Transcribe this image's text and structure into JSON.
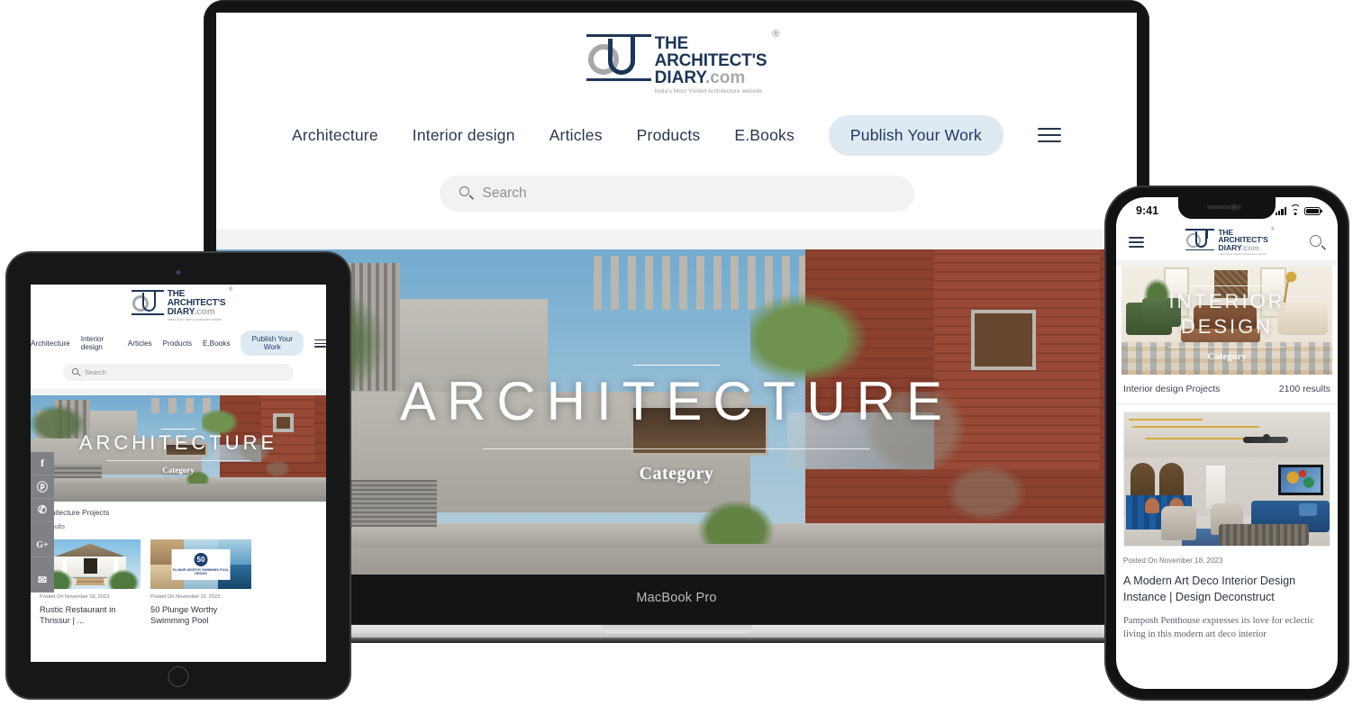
{
  "brand": {
    "line1": "THE",
    "line2": "ARCHITECT'S",
    "line3": "DIARY",
    "line3_dot": ".com",
    "tagline": "India's Most Visited Architecture website",
    "registered": "®",
    "navy": "#1d3557",
    "grey": "#a6a8ab"
  },
  "desktop": {
    "device_label": "MacBook Pro",
    "nav": [
      {
        "label": "Architecture"
      },
      {
        "label": "Interior design"
      },
      {
        "label": "Articles"
      },
      {
        "label": "Products"
      },
      {
        "label": "E.Books"
      }
    ],
    "publish_label": "Publish Your Work",
    "publish_bg": "#dfe9f2",
    "publish_text_color": "#1f3a63",
    "search": {
      "placeholder": "Search",
      "value": "",
      "icon": "search-icon"
    },
    "menu_icon": "hamburger-icon",
    "hero": {
      "title": "ARCHITECTURE",
      "subtitle": "Category"
    }
  },
  "tablet": {
    "nav": [
      {
        "label": "Architecture"
      },
      {
        "label": "Interior design"
      },
      {
        "label": "Articles"
      },
      {
        "label": "Products"
      },
      {
        "label": "E.Books"
      }
    ],
    "publish_label": "Publish Your Work",
    "search": {
      "placeholder": "Search",
      "value": ""
    },
    "menu_icon": "hamburger-icon",
    "hero": {
      "title": "ARCHITECTURE",
      "subtitle": "Category"
    },
    "results": {
      "label": "Architecture Projects",
      "count": "0 results"
    },
    "social": [
      {
        "name": "facebook-icon",
        "glyph": "f"
      },
      {
        "name": "pinterest-icon",
        "glyph": "ⓟ"
      },
      {
        "name": "whatsapp-icon",
        "glyph": "✆"
      },
      {
        "name": "googleplus-icon",
        "glyph": "G+"
      },
      {
        "name": "email-icon",
        "glyph": "✉"
      }
    ],
    "cards": [
      {
        "date": "Posted On November 16, 2023",
        "title": "Rustic Restaurant in Thrissur | ...",
        "image": "rustic-restaurant-photo"
      },
      {
        "date": "Posted On November 10, 2023",
        "title": "50 Plunge Worthy Swimming Pool",
        "image": "swimming-pool-collage",
        "badge_number": "50",
        "badge_text": "PLUNGE WORTHY SWIMMING POOL DESIGN"
      }
    ]
  },
  "phone": {
    "status": {
      "time": "9:41",
      "signal_icon": "cellular-bars-icon",
      "wifi_icon": "wifi-icon",
      "battery_icon": "battery-icon"
    },
    "menu_icon": "hamburger-icon",
    "search_icon": "search-icon",
    "hero": {
      "title": "INTERIOR DESIGN",
      "subtitle": "Category"
    },
    "results": {
      "label": "Interior design Projects",
      "count": "2100 results"
    },
    "card": {
      "date": "Posted On November 18, 2023",
      "title": "A Modern Art Deco Interior Design Instance | Design Deconstruct",
      "excerpt": "Pamposh Penthouse expresses its love for eclectic living in this modern art deco interior",
      "image": "art-deco-penthouse-photo"
    }
  }
}
